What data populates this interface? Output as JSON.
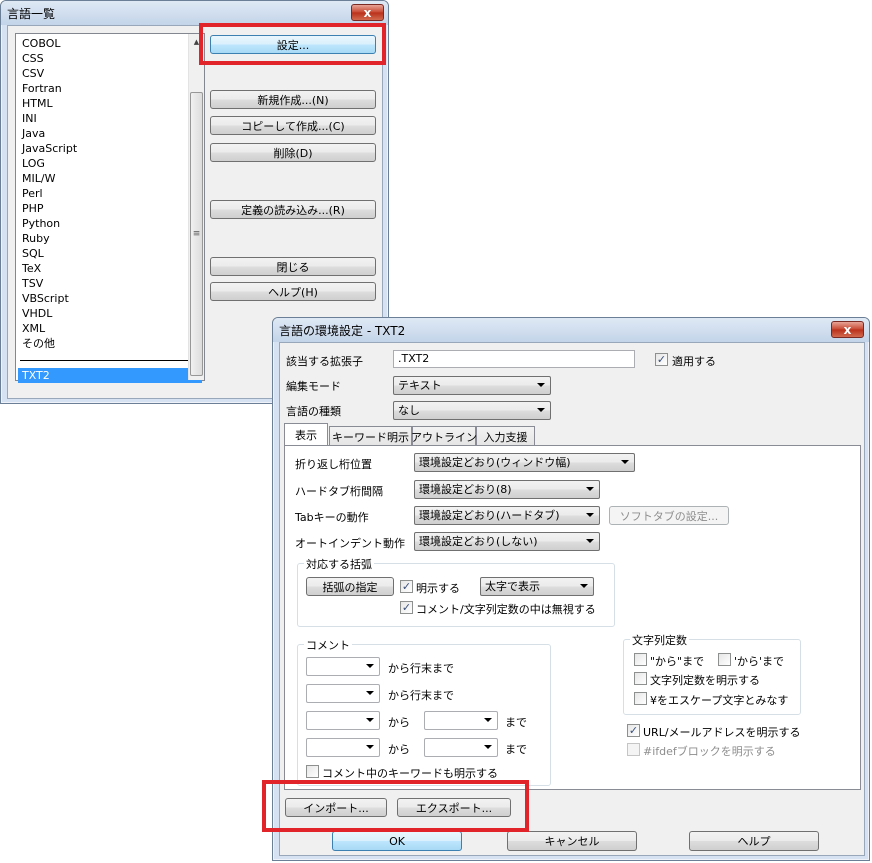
{
  "lang_list_window": {
    "title": "言語一覧",
    "close_glyph": "x",
    "items": [
      "COBOL",
      "CSS",
      "CSV",
      "Fortran",
      "HTML",
      "INI",
      "Java",
      "JavaScript",
      "LOG",
      "MIL/W",
      "Perl",
      "PHP",
      "Python",
      "Ruby",
      "SQL",
      "TeX",
      "TSV",
      "VBScript",
      "VHDL",
      "XML",
      "その他"
    ],
    "selected_item": "TXT2",
    "buttons": {
      "settings": "設定...",
      "new": "新規作成...(N)",
      "copy": "コピーして作成...(C)",
      "delete": "削除(D)",
      "load_def": "定義の読み込み...(R)",
      "close": "閉じる",
      "help": "ヘルプ(H)"
    }
  },
  "env_window": {
    "title": "言語の環境設定 - TXT2",
    "close_glyph": "x",
    "extension_label": "該当する拡張子",
    "extension_value": ".TXT2",
    "apply_label": "適用する",
    "apply_checked": true,
    "edit_mode_label": "編集モード",
    "edit_mode_value": "テキスト",
    "lang_type_label": "言語の種類",
    "lang_type_value": "なし",
    "tabs": [
      "表示",
      "キーワード明示",
      "アウトライン",
      "入力支援"
    ],
    "active_tab": "表示",
    "display": {
      "wrap_label": "折り返し桁位置",
      "wrap_value": "環境設定どおり(ウィンドウ幅)",
      "hardtab_label": "ハードタブ桁間隔",
      "hardtab_value": "環境設定どおり(8)",
      "tabkey_label": "Tabキーの動作",
      "tabkey_value": "環境設定どおり(ハードタブ)",
      "softtab_button": "ソフトタブの設定...",
      "autoindent_label": "オートインデント動作",
      "autoindent_value": "環境設定どおり(しない)"
    },
    "brackets_group": {
      "title": "対応する括弧",
      "specify_button": "括弧の指定",
      "show_label": "明示する",
      "show_checked": true,
      "style_value": "太字で表示",
      "ignore_label": "コメント/文字列定数の中は無視する",
      "ignore_checked": true
    },
    "comment_group": {
      "title": "コメント",
      "to_eol_1": "から行末まで",
      "to_eol_2": "から行末まで",
      "from_1": "から",
      "until_1": "まで",
      "from_2": "から",
      "until_2": "まで",
      "keywords_label": "コメント中のキーワードも明示する",
      "keywords_checked": false
    },
    "string_group": {
      "title": "文字列定数",
      "dq_label": "\"から\"まで",
      "dq_checked": false,
      "sq_label": "'から'まで",
      "sq_checked": false,
      "show_label": "文字列定数を明示する",
      "show_checked": false,
      "escape_label": "¥をエスケープ文字とみなす",
      "escape_checked": false
    },
    "url_label": "URL/メールアドレスを明示する",
    "url_checked": true,
    "ifdef_label": "#ifdefブロックを明示する",
    "ifdef_checked": false,
    "import_button": "インポート...",
    "export_button": "エクスポート...",
    "ok_button": "OK",
    "cancel_button": "キャンセル",
    "help_button": "ヘルプ"
  },
  "colors": {
    "highlight_red": "#e0242a",
    "selection_blue": "#3399ff"
  }
}
